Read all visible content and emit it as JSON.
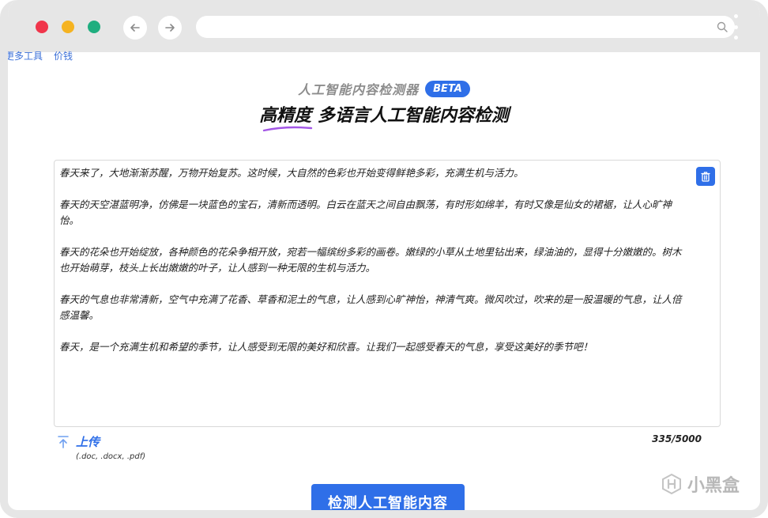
{
  "browser": {
    "address_value": ""
  },
  "top_links": [
    "更多工具",
    "价钱"
  ],
  "header": {
    "product_name": "人工智能内容检测器",
    "badge": "BETA",
    "headline_highlight": "高精度",
    "headline_rest": " 多语言人工智能内容检测"
  },
  "editor": {
    "paragraphs": [
      "春天来了，大地渐渐苏醒，万物开始复苏。这时候，大自然的色彩也开始变得鲜艳多彩，充满生机与活力。",
      "春天的天空湛蓝明净，仿佛是一块蓝色的宝石，清新而透明。白云在蓝天之间自由飘荡，有时形如绵羊，有时又像是仙女的裙裾，让人心旷神怡。",
      "春天的花朵也开始绽放，各种颜色的花朵争相开放，宛若一幅缤纷多彩的画卷。嫩绿的小草从土地里钻出来，绿油油的，显得十分嫩嫩的。树木也开始萌芽，枝头上长出嫩嫩的叶子，让人感到一种无限的生机与活力。",
      "春天的气息也非常清新，空气中充满了花香、草香和泥土的气息，让人感到心旷神怡，神清气爽。微风吹过，吹来的是一股温暖的气息，让人倍感温馨。",
      "春天，是一个充满生机和希望的季节，让人感受到无限的美好和欣喜。让我们一起感受春天的气息，享受这美好的季节吧！"
    ],
    "char_count": "335/5000",
    "delete_icon": "trash-icon"
  },
  "upload": {
    "label": "上传",
    "hint": "(.doc, .docx, .pdf)"
  },
  "actions": {
    "detect_label": "检测人工智能内容"
  },
  "watermark": {
    "text": "小黑盒"
  },
  "colors": {
    "accent": "#2f6fe8",
    "frame": "#e6e6e6",
    "traffic_red": "#f0354b",
    "traffic_yellow": "#f5b321",
    "traffic_green": "#1fae7f",
    "highlight_underline": "#a357e6"
  }
}
